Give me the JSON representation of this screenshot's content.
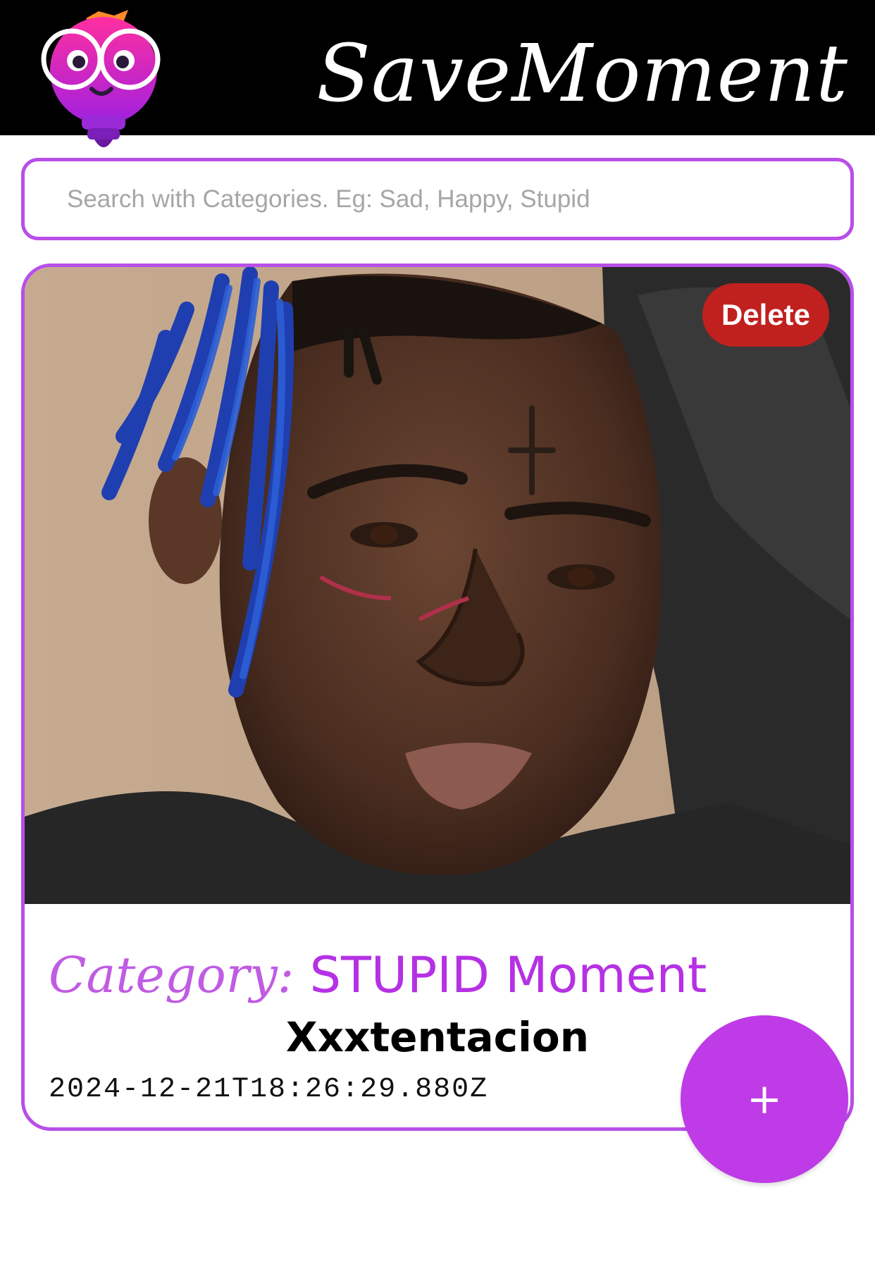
{
  "header": {
    "app_title": "SaveMoment",
    "logo_icon": "lightbulb-glasses-mascot-icon"
  },
  "search": {
    "placeholder": "Search with Categories. Eg: Sad, Happy, Stupid",
    "value": ""
  },
  "moments": [
    {
      "delete_label": "Delete",
      "category_prefix": "Category: ",
      "category_value": "STUPID Moment",
      "title": "Xxxtentacion",
      "timestamp": "2024-12-21T18:26:29.880Z",
      "image": "portrait-photo"
    }
  ],
  "fab": {
    "label": "+",
    "icon": "plus-icon"
  },
  "colors": {
    "accent": "#b84fe8",
    "fab": "#be3be7",
    "delete": "#c0211f",
    "header_bg": "#000000"
  }
}
